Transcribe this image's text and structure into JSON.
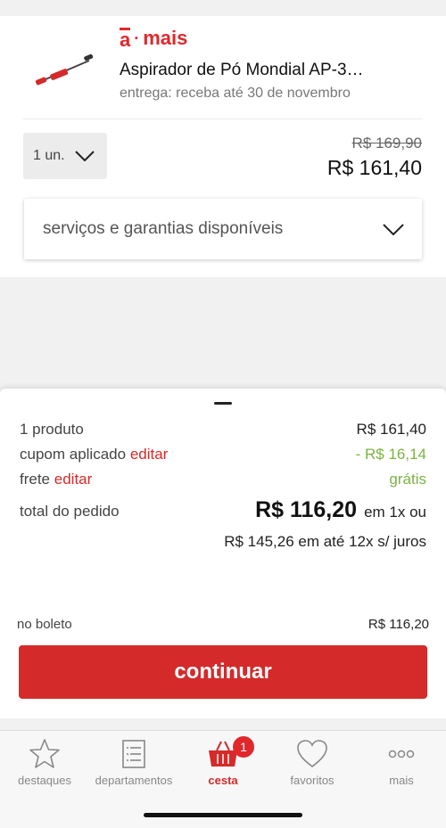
{
  "product": {
    "brand_prefix": "a",
    "brand_dot": "·",
    "brand_name": "mais",
    "title": "Aspirador de Pó Mondial AP-3…",
    "delivery": "entrega: receba até 30 de novembro",
    "quantity": "1 un.",
    "old_price": "R$ 169,90",
    "price": "R$ 161,40",
    "services_label": "serviços e garantias disponíveis"
  },
  "summary": {
    "products_label": "1 produto",
    "products_value": "R$ 161,40",
    "coupon_label": "cupom aplicado",
    "coupon_edit": "editar",
    "coupon_value": "- R$ 16,14",
    "shipping_label": "frete",
    "shipping_edit": "editar",
    "shipping_value": "grátis",
    "total_label": "total do pedido",
    "total_value": "R$ 116,20",
    "total_suffix": "em 1x ou",
    "installments": "R$ 145,26 em até 12x s/ juros"
  },
  "payment": {
    "boleto_label": "no boleto",
    "boleto_value": "R$ 116,20",
    "continue_label": "continuar"
  },
  "tabbar": {
    "items": [
      {
        "label": "destaques",
        "icon": "star-icon"
      },
      {
        "label": "departamentos",
        "icon": "list-icon"
      },
      {
        "label": "cesta",
        "icon": "basket-icon",
        "badge": "1"
      },
      {
        "label": "favoritos",
        "icon": "heart-icon"
      },
      {
        "label": "mais",
        "icon": "more-icon"
      }
    ]
  },
  "colors": {
    "accent": "#d42a2a",
    "discount": "#7cb342"
  }
}
